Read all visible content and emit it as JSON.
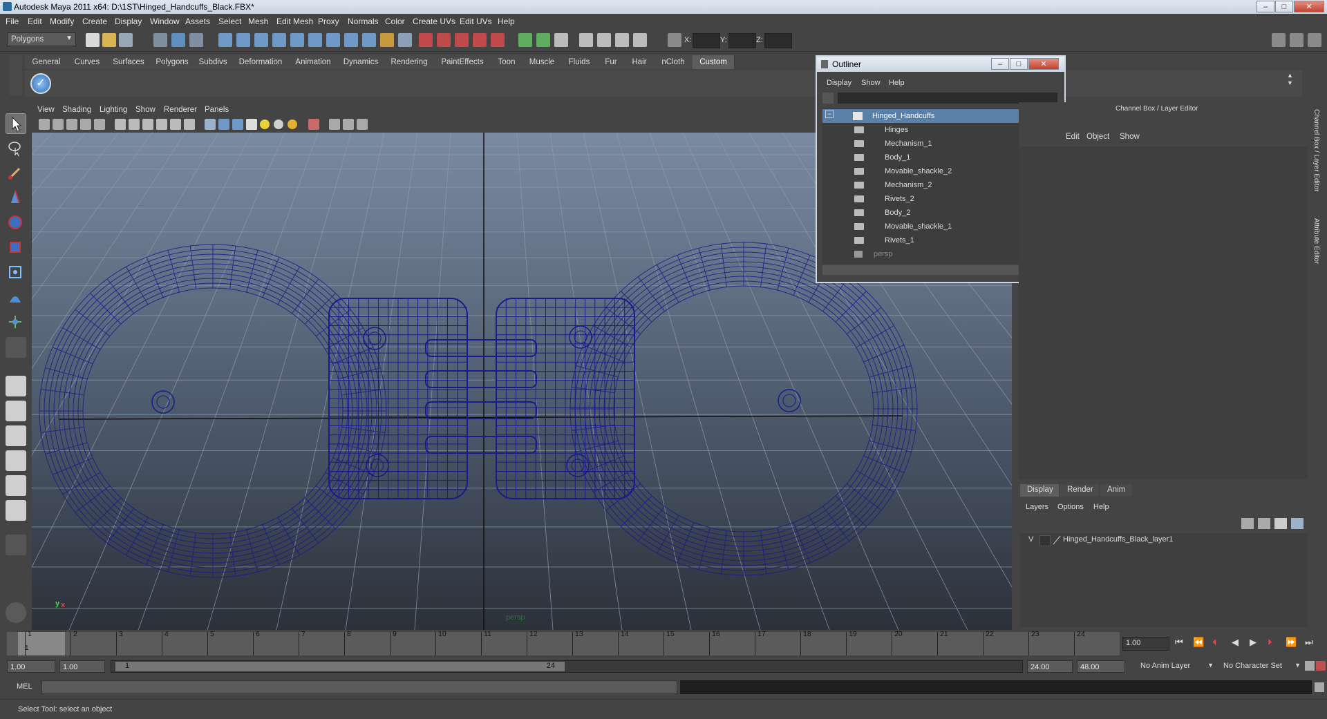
{
  "window": {
    "title": "Autodesk Maya 2011 x64: D:\\1ST\\Hinged_Handcuffs_Black.FBX*",
    "minimize_label": "–",
    "maximize_label": "□",
    "close_label": "✕"
  },
  "menubar": [
    "File",
    "Edit",
    "Modify",
    "Create",
    "Display",
    "Window",
    "Assets",
    "Select",
    "Mesh",
    "Edit Mesh",
    "Proxy",
    "Normals",
    "Color",
    "Create UVs",
    "Edit UVs",
    "Help"
  ],
  "statusline": {
    "mode": "Polygons",
    "x_label": "X:",
    "y_label": "Y:",
    "z_label": "Z:"
  },
  "shelf": {
    "tabs": [
      "General",
      "Curves",
      "Surfaces",
      "Polygons",
      "Subdivs",
      "Deformation",
      "Animation",
      "Dynamics",
      "Rendering",
      "PaintEffects",
      "Toon",
      "Muscle",
      "Fluids",
      "Fur",
      "Hair",
      "nCloth",
      "Custom"
    ],
    "active_tab": "Custom"
  },
  "viewport": {
    "menu": [
      "View",
      "Shading",
      "Lighting",
      "Show",
      "Renderer",
      "Panels"
    ],
    "camera_label": "persp",
    "axis_x": "x",
    "axis_y": "y",
    "wire_color": "#1a1a8c"
  },
  "outliner": {
    "title": "Outliner",
    "menu": [
      "Display",
      "Show",
      "Help"
    ],
    "root": "Hinged_Handcuffs",
    "children": [
      "Hinges",
      "Mechanism_1",
      "Body_1",
      "Movable_shackle_2",
      "Mechanism_2",
      "Rivets_2",
      "Body_2",
      "Movable_shackle_1",
      "Rivets_1"
    ],
    "camera": "persp"
  },
  "channelbox": {
    "title": "Channel Box / Layer Editor",
    "menu": [
      "Edit",
      "Object",
      "Show"
    ],
    "side_tab_1": "Channel Box / Layer Editor",
    "side_tab_2": "Attribute Editor"
  },
  "layer_editor": {
    "tabs": [
      "Display",
      "Render",
      "Anim"
    ],
    "menu": [
      "Layers",
      "Options",
      "Help"
    ],
    "layer_visible": "V",
    "layer_name": "Hinged_Handcuffs_Black_layer1"
  },
  "timeline": {
    "ticks": [
      "1",
      "2",
      "3",
      "4",
      "5",
      "6",
      "7",
      "8",
      "9",
      "10",
      "11",
      "12",
      "13",
      "14",
      "15",
      "16",
      "17",
      "18",
      "19",
      "20",
      "21",
      "22",
      "23",
      "24"
    ],
    "current_frame": "1.00",
    "current_marker": "1"
  },
  "range": {
    "start": "1.00",
    "start2": "1.00",
    "slider_start": "1",
    "slider_end": "24",
    "end": "24.00",
    "end2": "48.00",
    "anim_layer": "No Anim Layer",
    "char_set": "No Character Set"
  },
  "cmdline": {
    "label": "MEL"
  },
  "helpline": {
    "text": "Select Tool: select an object"
  }
}
